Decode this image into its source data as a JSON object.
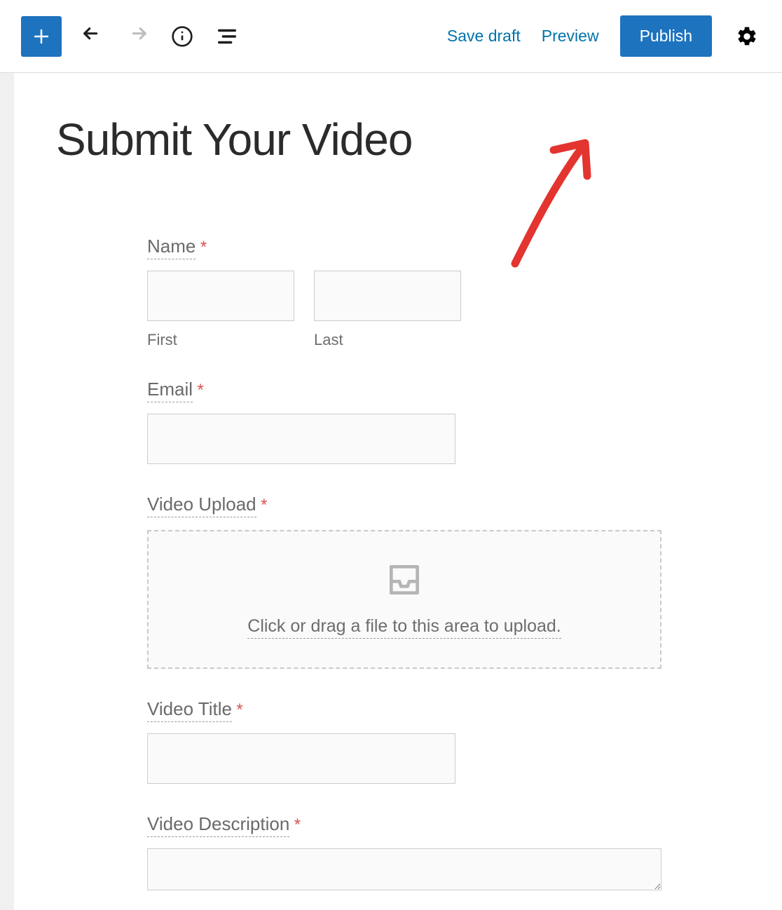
{
  "toolbar": {
    "save_draft": "Save draft",
    "preview": "Preview",
    "publish": "Publish"
  },
  "page": {
    "title": "Submit Your Video"
  },
  "form": {
    "name": {
      "label": "Name",
      "required": "*",
      "first_sub": "First",
      "last_sub": "Last"
    },
    "email": {
      "label": "Email",
      "required": "*"
    },
    "upload": {
      "label": "Video Upload",
      "required": "*",
      "hint": "Click or drag a file to this area to upload."
    },
    "video_title": {
      "label": "Video Title",
      "required": "*"
    },
    "video_description": {
      "label": "Video Description",
      "required": "*"
    }
  }
}
